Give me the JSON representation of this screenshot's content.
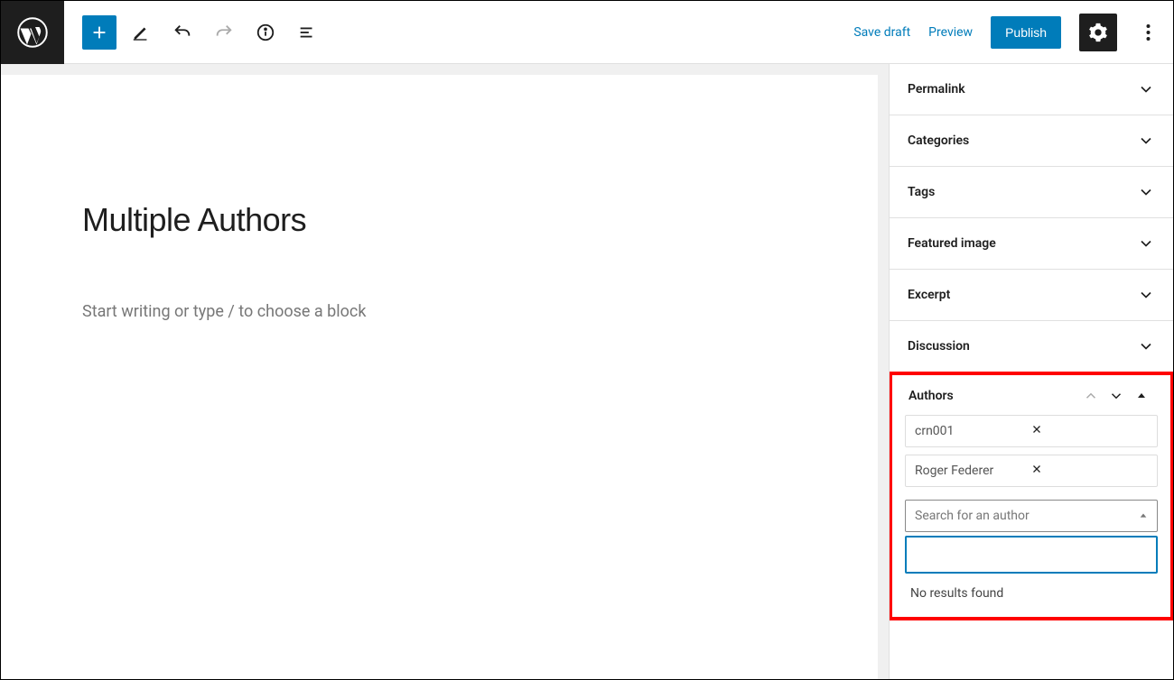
{
  "topbar": {
    "save_draft": "Save draft",
    "preview": "Preview",
    "publish": "Publish"
  },
  "post": {
    "title": "Multiple Authors",
    "placeholder": "Start writing or type / to choose a block"
  },
  "sidebar": {
    "panels": [
      {
        "label": "Permalink"
      },
      {
        "label": "Categories"
      },
      {
        "label": "Tags"
      },
      {
        "label": "Featured image"
      },
      {
        "label": "Excerpt"
      },
      {
        "label": "Discussion"
      }
    ],
    "authors": {
      "title": "Authors",
      "list": [
        {
          "name": "crn001"
        },
        {
          "name": "Roger Federer"
        }
      ],
      "search_placeholder": "Search for an author",
      "no_results": "No results found"
    }
  }
}
